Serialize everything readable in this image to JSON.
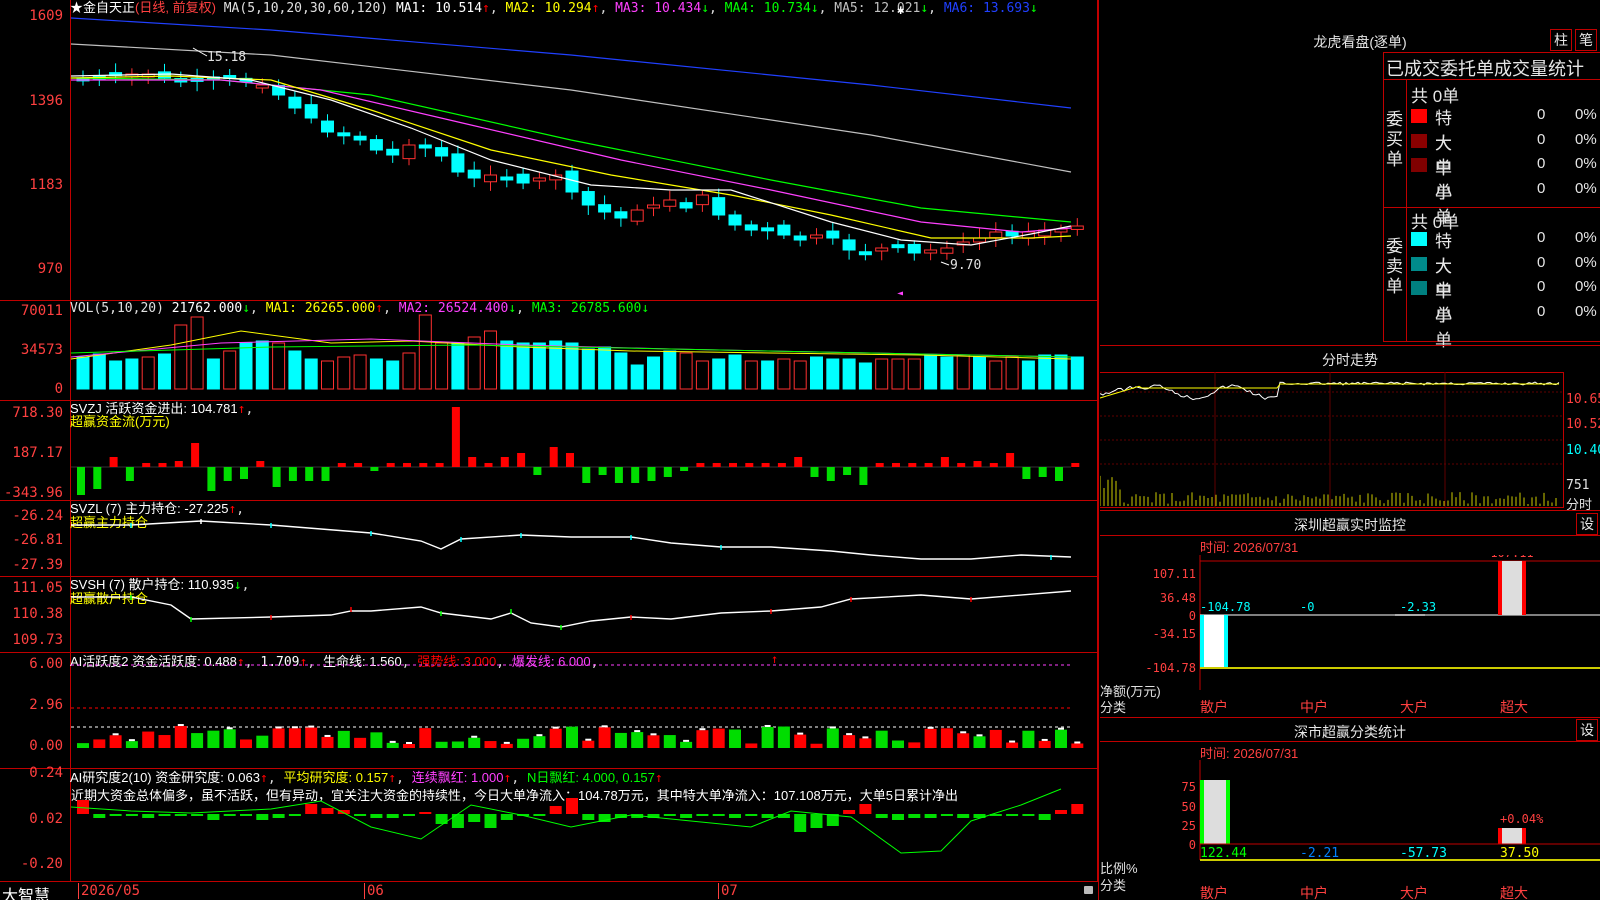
{
  "app": {
    "brand": "大智慧"
  },
  "stock": {
    "name": "★金自天正",
    "period": "(日线, 前复权)",
    "ma_label": "MA(5,10,20,30,60,120)",
    "ma": [
      {
        "label": "MA1: 10.514",
        "arrow": "↑",
        "color": "#ffffff"
      },
      {
        "label": "MA2: 10.294",
        "arrow": "↑",
        "color": "#ffff00"
      },
      {
        "label": "MA3: 10.434",
        "arrow": "↓",
        "color": "#ff40ff"
      },
      {
        "label": "MA4: 10.734",
        "arrow": "↓",
        "color": "#00ff00"
      },
      {
        "label": "MA5: 12.021",
        "arrow": "↓",
        "color": "#c0c0c0"
      },
      {
        "label": "MA6: 13.693",
        "arrow": "↓",
        "color": "#2040ff"
      }
    ],
    "y_ticks": [
      "1609",
      "1396",
      "1183",
      "970"
    ],
    "high_label": "15.18",
    "low_label": "9.70"
  },
  "vol": {
    "label": "VOL(5,10,20)",
    "value": "21762.000",
    "ma1": "MA1: 26265.000",
    "ma2": "MA2: 26524.400",
    "ma3": "MA3: 26785.600",
    "y_ticks": [
      "70011",
      "34573",
      "0"
    ]
  },
  "svzj": {
    "label": "SVZJ  活跃资金进出: 104.781",
    "sub": "超赢资金流(万元)",
    "y_ticks": [
      "718.30",
      "187.17",
      "-343.96"
    ]
  },
  "svzl": {
    "label": "SVZL (7) 主力持仓: -27.225",
    "sub": "超赢主力持仓",
    "y_ticks": [
      "-26.24",
      "-26.81",
      "-27.39"
    ]
  },
  "svsh": {
    "label": "SVSH (7) 散户持仓: 110.935",
    "sub": "超赢散户持仓",
    "y_ticks": [
      "111.05",
      "110.38",
      "109.73"
    ]
  },
  "ai_active": {
    "label": "AI活跃度2 资金活跃度: 0.488",
    "v2": "1.709",
    "life": "生命线: 1.560",
    "strong": "强势线: 3.000",
    "burst": "爆发线: 6.000",
    "y_ticks": [
      "6.00",
      "2.96",
      "0.00"
    ]
  },
  "ai_research": {
    "label": "AI研究度2(10) 资金研究度: 0.063",
    "avg": "平均研究度: 0.157",
    "red": "连续飘红: 1.000",
    "nday": "N日飘红: 4.000, 0.157",
    "comment": "近期大资金总体偏多，虽不活跃，但有异动，宜关注大资金的持续性，今日大单净流入：104.78万元，其中特大单净流入：107.108万元，大单5日累计净出",
    "y_ticks": [
      "0.24",
      "0.02",
      "-0.20"
    ]
  },
  "x_axis": {
    "labels": [
      "2026/05",
      "06",
      "07"
    ]
  },
  "right": {
    "lhb_title": "龙虎看盘(逐单)",
    "btn_bar": "柱",
    "btn_pen": "笔",
    "stats_title": "已成交委托单成交量统计",
    "buy_side": "委买单",
    "sell_side": "委卖单",
    "buy_total": "共 0单",
    "sell_total": "共 0单",
    "rows": [
      {
        "name": "特大",
        "val": "0",
        "pct": "0%"
      },
      {
        "name": "大单",
        "val": "0",
        "pct": "0%"
      },
      {
        "name": "中单",
        "val": "0",
        "pct": "0%"
      },
      {
        "name": "小单",
        "val": "0",
        "pct": "0%"
      }
    ],
    "buy_colors": [
      "#ff0000",
      "#8b0000",
      "#800000"
    ],
    "sell_colors": [
      "#00ffff",
      "#008b8b",
      "#008080"
    ],
    "intraday_title": "分时走势",
    "intraday_prices": [
      "10.65",
      "10.52",
      "10.40"
    ],
    "intraday_vol": "751",
    "intraday_label": "分时",
    "sz_title": "深圳超赢实时监控",
    "sz_btn": "设",
    "sz_time": "时间: 2026/07/31",
    "sz_ticks": [
      "107.11",
      "36.48",
      "0",
      "-34.15",
      "-104.78"
    ],
    "sz_top": "107.11",
    "sz_vals": [
      "-104.78",
      "-0",
      "-2.33"
    ],
    "sz_unit": "净额(万元)",
    "sz_cat": "分类",
    "cats": [
      "散户",
      "中户",
      "大户",
      "超大"
    ],
    "cls_title": "深市超赢分类统计",
    "cls_btn": "设",
    "cls_time": "时间: 2026/07/31",
    "cls_ticks": [
      "75",
      "50",
      "25",
      "0"
    ],
    "cls_top": "+0.04%",
    "cls_unit": "比例%",
    "cls_cat": "分类",
    "cls_vals": [
      "122.44",
      "-2.21",
      "-57.73",
      "37.50"
    ]
  }
}
